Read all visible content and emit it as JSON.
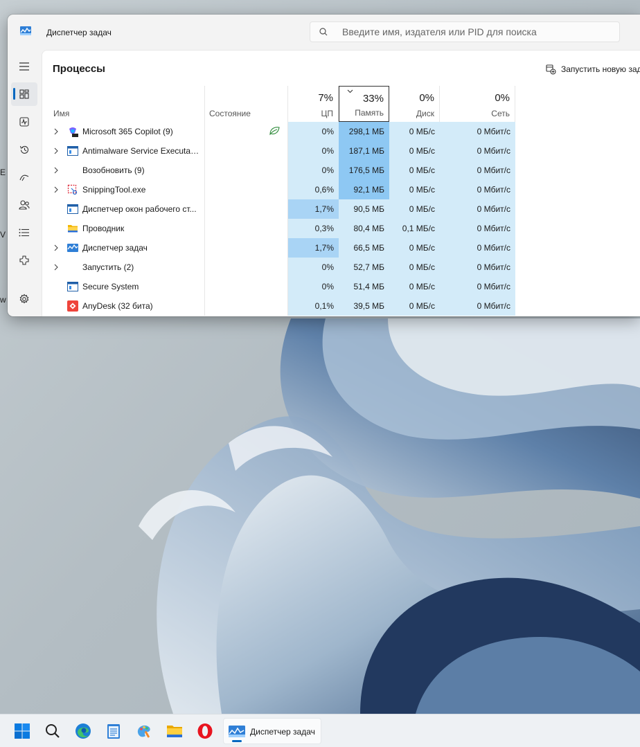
{
  "window": {
    "title": "Диспетчер задач",
    "search_placeholder": "Введите имя, издателя или PID для поиска"
  },
  "sidebar": {
    "items": [
      {
        "icon": "hamburger-menu-icon"
      },
      {
        "icon": "processes-icon",
        "active": true
      },
      {
        "icon": "performance-icon"
      },
      {
        "icon": "app-history-icon"
      },
      {
        "icon": "startup-apps-icon"
      },
      {
        "icon": "users-icon"
      },
      {
        "icon": "details-icon"
      },
      {
        "icon": "services-icon"
      },
      {
        "icon": "settings-gear-icon"
      }
    ]
  },
  "page": {
    "title": "Процессы",
    "run_new_task": "Запустить новую зад"
  },
  "columns": {
    "name": "Имя",
    "status": "Состояние",
    "cpu": {
      "pct": "7%",
      "label": "ЦП"
    },
    "memory": {
      "pct": "33%",
      "label": "Память"
    },
    "disk": {
      "pct": "0%",
      "label": "Диск"
    },
    "network": {
      "pct": "0%",
      "label": "Сеть"
    }
  },
  "processes": [
    {
      "name": "Microsoft 365 Copilot (9)",
      "expandable": true,
      "icon": "copilot-icon",
      "status_icon": "efficiency-leaf-icon",
      "cpu": "0%",
      "memory": "298,1 МБ",
      "disk": "0 МБ/с",
      "network": "0 Мбит/с"
    },
    {
      "name": "Antimalware Service Executable",
      "expandable": true,
      "icon": "system-app-icon",
      "cpu": "0%",
      "memory": "187,1 МБ",
      "disk": "0 МБ/с",
      "network": "0 Мбит/с"
    },
    {
      "name": "Возобновить (9)",
      "expandable": true,
      "icon": "",
      "cpu": "0%",
      "memory": "176,5 МБ",
      "disk": "0 МБ/с",
      "network": "0 Мбит/с"
    },
    {
      "name": "SnippingTool.exe",
      "expandable": true,
      "icon": "snipping-tool-icon",
      "cpu": "0,6%",
      "memory": "92,1 МБ",
      "disk": "0 МБ/с",
      "network": "0 Мбит/с"
    },
    {
      "name": "Диспетчер окон рабочего ст...",
      "expandable": false,
      "icon": "system-app-icon",
      "cpu": "1,7%",
      "memory": "90,5 МБ",
      "disk": "0 МБ/с",
      "network": "0 Мбит/с"
    },
    {
      "name": "Проводник",
      "expandable": false,
      "icon": "folder-icon",
      "cpu": "0,3%",
      "memory": "80,4 МБ",
      "disk": "0,1 МБ/с",
      "network": "0 Мбит/с"
    },
    {
      "name": "Диспетчер задач",
      "expandable": true,
      "icon": "task-manager-icon",
      "cpu": "1,7%",
      "memory": "66,5 МБ",
      "disk": "0 МБ/с",
      "network": "0 Мбит/с"
    },
    {
      "name": "Запустить (2)",
      "expandable": true,
      "icon": "",
      "cpu": "0%",
      "memory": "52,7 МБ",
      "disk": "0 МБ/с",
      "network": "0 Мбит/с"
    },
    {
      "name": "Secure System",
      "expandable": false,
      "icon": "system-app-icon",
      "cpu": "0%",
      "memory": "51,4 МБ",
      "disk": "0 МБ/с",
      "network": "0 Мбит/с"
    },
    {
      "name": "AnyDesk (32 бита)",
      "expandable": false,
      "icon": "anydesk-icon",
      "cpu": "0,1%",
      "memory": "39,5 МБ",
      "disk": "0 МБ/с",
      "network": "0 Мбит/с"
    }
  ],
  "desktop_fragments": [
    "E",
    "V",
    "w"
  ],
  "taskbar": {
    "items": [
      {
        "icon": "windows-start-icon"
      },
      {
        "icon": "search-icon"
      },
      {
        "icon": "edge-browser-icon"
      },
      {
        "icon": "notepad-icon"
      },
      {
        "icon": "paint-icon"
      },
      {
        "icon": "file-explorer-icon"
      },
      {
        "icon": "opera-browser-icon"
      }
    ],
    "running_app_label": "Диспетчер задач"
  },
  "colors": {
    "accent": "#0067c0",
    "heat_light": "#d3ebf9",
    "heat_mid": "#a9d4f5",
    "heat_strong": "#8ec8f3"
  }
}
